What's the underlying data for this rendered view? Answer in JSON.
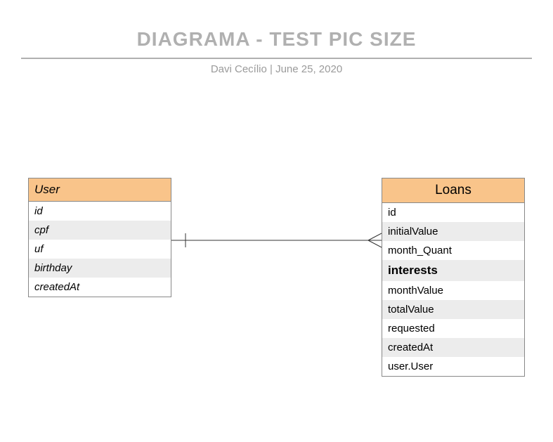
{
  "header": {
    "title": "DIAGRAMA - TEST PIC SIZE",
    "author": "Davi Cecílio",
    "separator": "  |  ",
    "date": "June 25, 2020"
  },
  "entities": {
    "user": {
      "name": "User",
      "attrs": [
        "id",
        "cpf",
        "uf",
        "birthday",
        "createdAt"
      ]
    },
    "loans": {
      "name": "Loans",
      "attrs": [
        "id",
        "initialValue",
        "month_Quant",
        "interests",
        "monthValue",
        "totalValue",
        "requested",
        "createdAt",
        "user.User"
      ]
    }
  },
  "relationship": {
    "from": "User",
    "to": "Loans",
    "type": "one-to-many"
  }
}
